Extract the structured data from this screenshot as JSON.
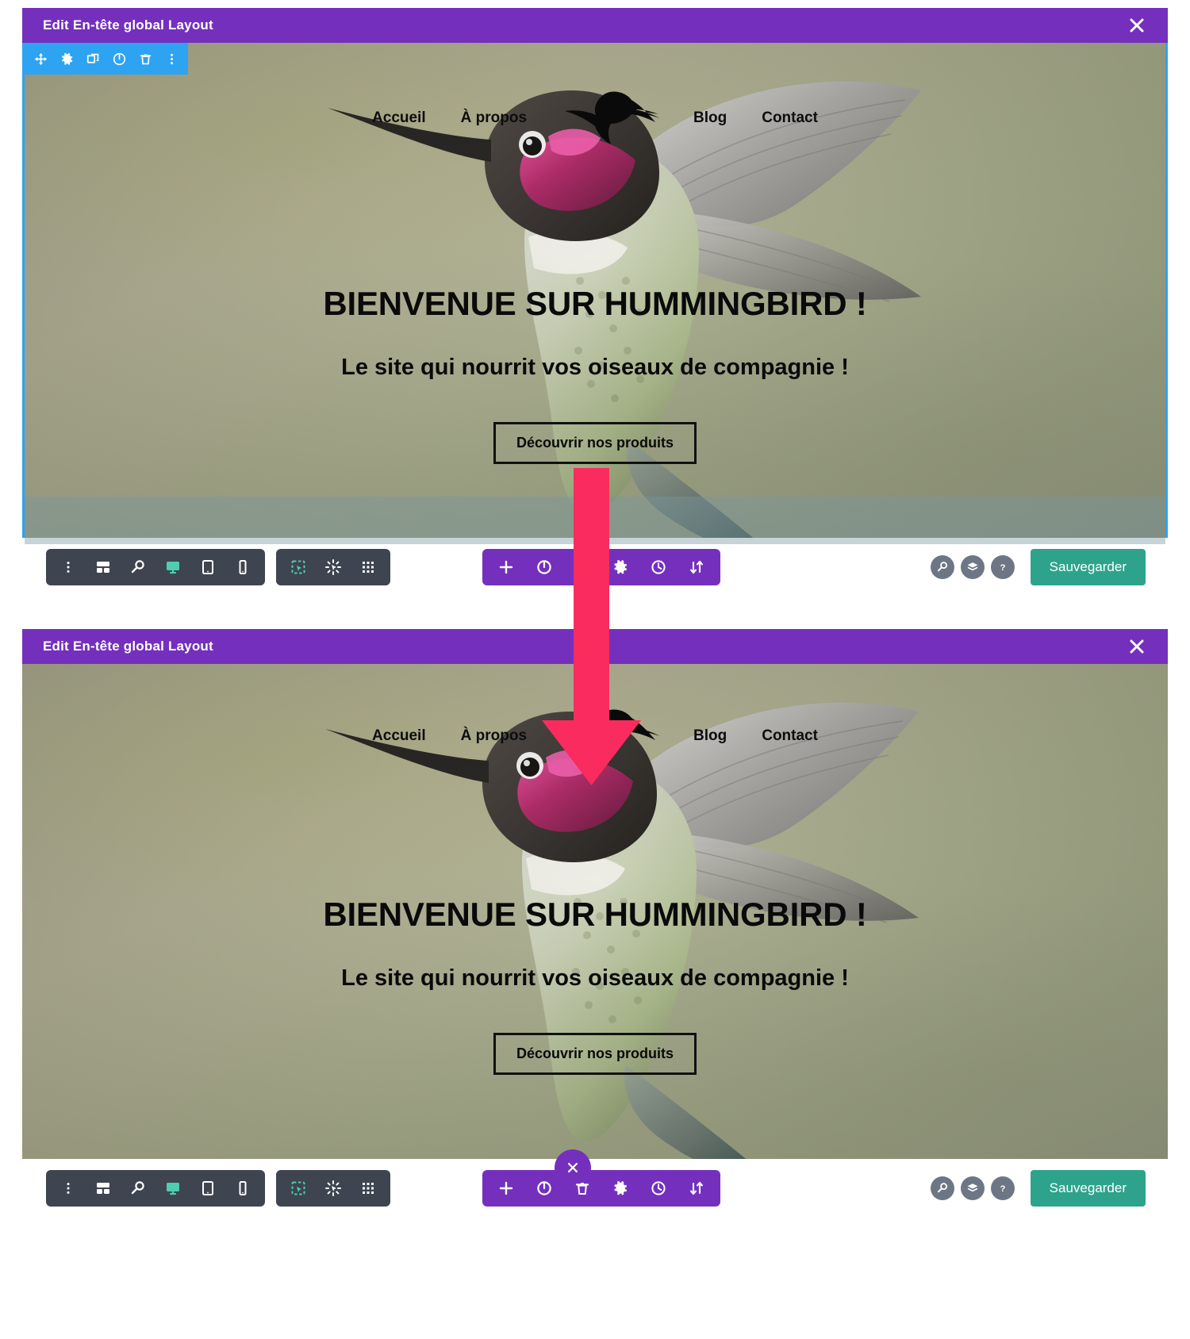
{
  "colors": {
    "titlebar_purple": "#7430bd",
    "builder_blue": "#2ea3f2",
    "toolbar_dark": "#3e4450",
    "save_green": "#2ea38c",
    "arrow_pink": "#fa2b5e",
    "active_teal": "#4ecdaf"
  },
  "panels": [
    {
      "id": "panel-top",
      "titlebar": {
        "title": "Edit En-tête global Layout",
        "close_icon": "close-icon"
      },
      "module_toolbar": {
        "visible": true,
        "icons": [
          "move-icon",
          "gear-icon",
          "duplicate-icon",
          "power-icon",
          "trash-icon",
          "more-vertical-icon"
        ]
      },
      "nav": {
        "links_left": [
          "Accueil",
          "À propos"
        ],
        "links_right": [
          "Blog",
          "Contact"
        ],
        "logo_icon": "hummingbird-logo"
      },
      "hero": {
        "title": "BIENVENUE SUR HUMMINGBIRD !",
        "subtitle": "Le site qui nourrit vos oiseaux de compagnie !",
        "cta_label": "Découvrir nos produits"
      },
      "section_hover_tint": true,
      "fab_visible": false
    },
    {
      "id": "panel-bottom",
      "titlebar": {
        "title": "Edit En-tête global Layout",
        "close_icon": "close-icon"
      },
      "module_toolbar": {
        "visible": false,
        "icons": []
      },
      "nav": {
        "links_left": [
          "Accueil",
          "À propos"
        ],
        "links_right": [
          "Blog",
          "Contact"
        ],
        "logo_icon": "hummingbird-logo"
      },
      "hero": {
        "title": "BIENVENUE SUR HUMMINGBIRD !",
        "subtitle": "Le site qui nourrit vos oiseaux de compagnie !",
        "cta_label": "Découvrir nos produits"
      },
      "section_hover_tint": false,
      "fab_visible": true,
      "fab_icon": "close-icon"
    }
  ],
  "bottom_bar": {
    "left_pill_icons": [
      "more-vertical-icon",
      "layout-icon",
      "search-icon",
      "desktop-icon",
      "tablet-icon",
      "phone-icon"
    ],
    "left_pill_active": "desktop-icon",
    "second_pill_icons": [
      "wireframe-icon",
      "click-mode-icon",
      "grid-icon"
    ],
    "center_pill_icons": [
      "plus-icon",
      "power-icon",
      "trash-icon",
      "gear-icon",
      "history-clock-icon",
      "sort-updown-icon"
    ],
    "right_round_icons": [
      "search-icon",
      "layers-icon",
      "help-icon"
    ],
    "save_label": "Sauvegarder"
  },
  "annotation": {
    "arrow_icon": "down-arrow-annotation",
    "color": "#fa2b5e"
  }
}
